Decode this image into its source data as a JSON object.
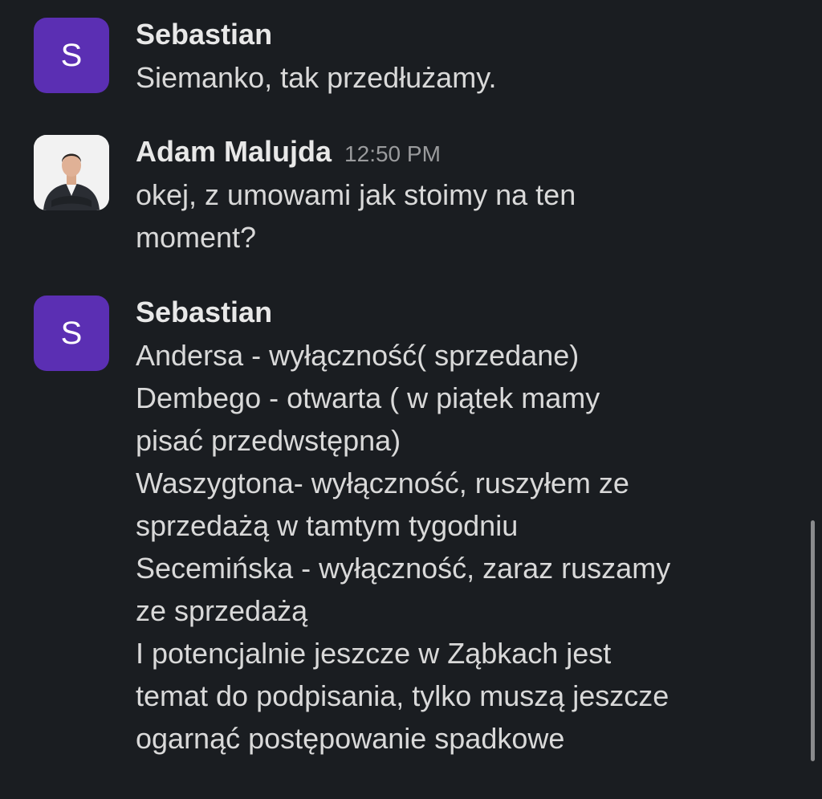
{
  "messages": [
    {
      "author": "Sebastian",
      "avatar_letter": "S",
      "timestamp": "",
      "lines": [
        "Siemanko, tak przedłużamy."
      ]
    },
    {
      "author": "Adam Malujda",
      "avatar_letter": "",
      "timestamp": "12:50 PM",
      "lines": [
        "okej, z umowami jak stoimy na ten",
        "moment?"
      ]
    },
    {
      "author": "Sebastian",
      "avatar_letter": "S",
      "timestamp": "",
      "lines": [
        "Andersa - wyłączność( sprzedane)",
        "Dembego - otwarta ( w piątek mamy",
        "pisać przedwstępna)",
        "Waszygtona- wyłączność, ruszyłem ze",
        "sprzedażą w tamtym tygodniu",
        "Secemińska - wyłączność, zaraz ruszamy",
        "ze sprzedażą",
        "I potencjalnie jeszcze w Ząbkach  jest",
        "temat do podpisania, tylko muszą jeszcze",
        "ogarnąć postępowanie spadkowe"
      ]
    }
  ],
  "colors": {
    "background": "#1a1d21",
    "avatar_purple": "#5b2fb3",
    "text": "#d9d9d9",
    "timestamp": "#9a9b9d"
  }
}
